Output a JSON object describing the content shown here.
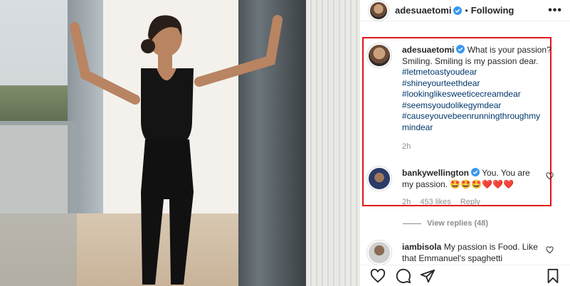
{
  "post": {
    "username": "adesuaetomi",
    "follow_status": "Following",
    "more_label": "•••"
  },
  "caption": {
    "username": "adesuaetomi",
    "text": "What is your passion? Smiling. Smiling is my passion dear.",
    "hashtags": [
      "#letmetoastyoudear",
      "#shineyourteethdear",
      "#lookinglikesweeticecreamdear",
      "#seemsyoudolikegymdear",
      "#causeyouvebeenrunningthroughmy mindear"
    ],
    "time": "2h"
  },
  "comments": [
    {
      "username": "bankywellington",
      "text": "You. You are my passion. 🤩🤩🤩❤️❤️❤️",
      "time": "2h",
      "likes": "453 likes",
      "reply": "Reply"
    },
    {
      "username": "iambisola",
      "text": "My passion is Food. Like that Emmanuel's spaghetti"
    }
  ],
  "view_replies": "View replies (48)",
  "icons": [
    "heart-icon",
    "comment-icon",
    "share-icon",
    "bookmark-icon",
    "verified-icon",
    "more-icon"
  ],
  "colors": {
    "highlight": "#e0141e",
    "hashtag": "#00376b",
    "verified": "#3897f0",
    "muted": "#8e8e8e"
  }
}
